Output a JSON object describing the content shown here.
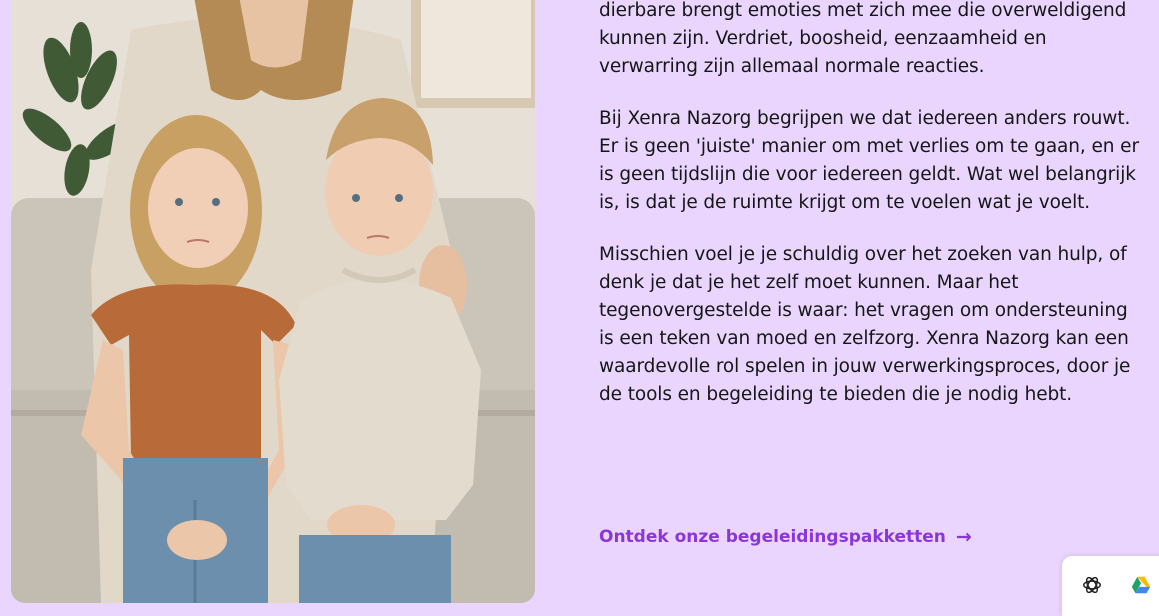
{
  "article": {
    "paragraphs": [
      "dierbare brengt emoties met zich mee die overweldigend kunnen zijn. Verdriet, boosheid, eenzaamheid en verwarring zijn allemaal normale reacties.",
      "Bij Xenra Nazorg begrijpen we dat iedereen anders rouwt. Er is geen 'juiste' manier om met verlies om te gaan, en er is geen tijdslijn die voor iedereen geldt. Wat wel belangrijk is, is dat je de ruimte krijgt om te voelen wat je voelt.",
      "Misschien voel je je schuldig over het zoeken van hulp, of denk je dat je het zelf moet kunnen. Maar het tegenovergestelde is waar: het vragen om ondersteuning is een teken van moed en zelfzorg. Xenra Nazorg kan een waardevolle rol spelen in jouw verwerkingsproces, door je de tools en begeleiding te bieden die je nodig hebt."
    ],
    "cta_label": "Ontdek onze begeleidingspakketten",
    "cta_icon": "arrow-right-icon"
  },
  "photo": {
    "subject": "family-photo"
  },
  "dock": {
    "icons": [
      "openai-icon",
      "google-drive-icon"
    ]
  },
  "colors": {
    "background": "#e9d5fd",
    "text": "#161616",
    "accent": "#8b36d6"
  }
}
